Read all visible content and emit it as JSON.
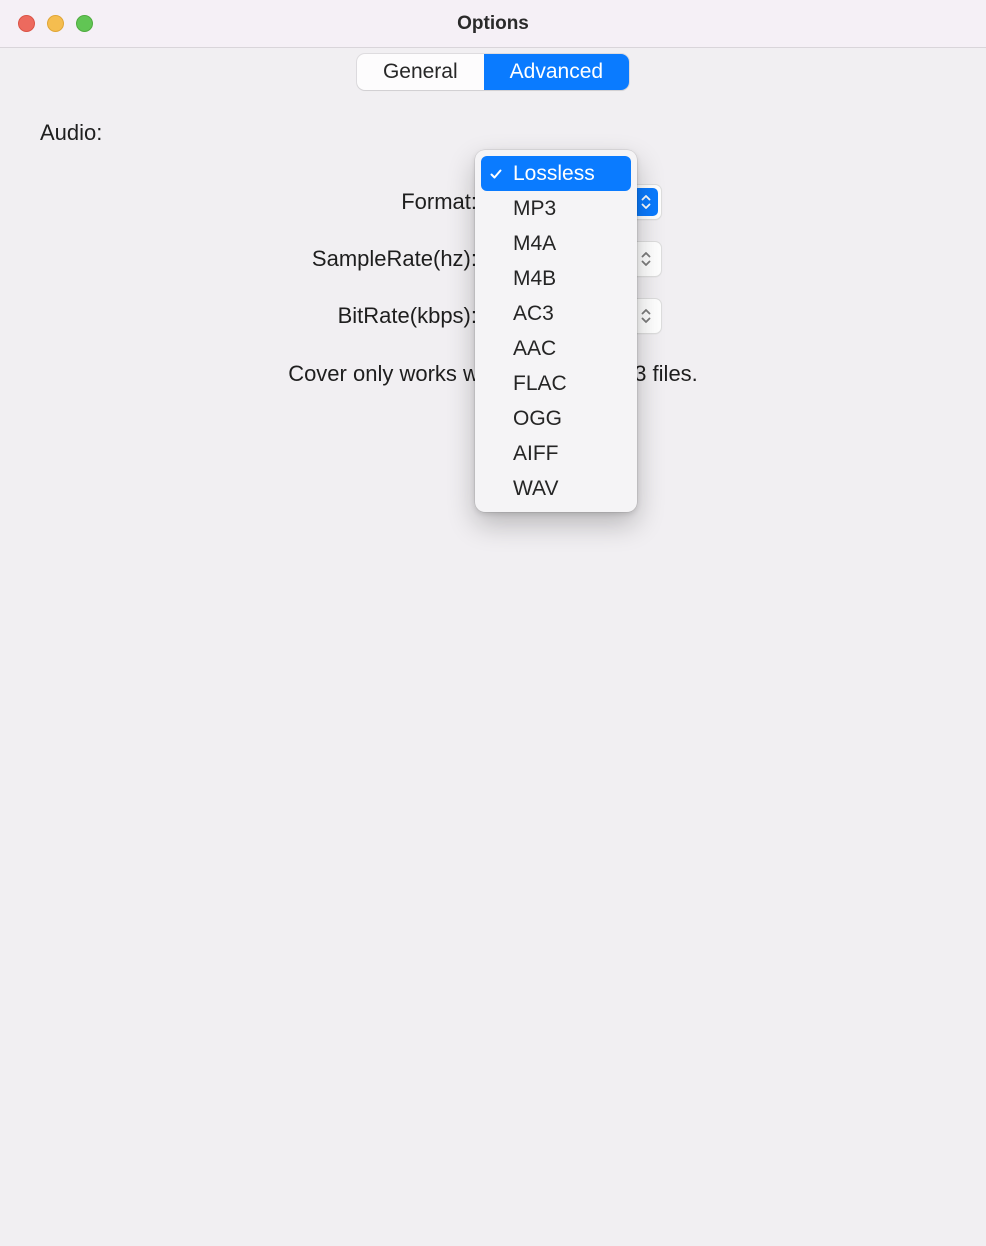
{
  "window": {
    "title": "Options"
  },
  "tabs": {
    "general": "General",
    "advanced": "Advanced"
  },
  "section": {
    "audio": "Audio:"
  },
  "labels": {
    "format": "Format:",
    "sampleRate": "SampleRate(hz):",
    "bitRate": "BitRate(kbps):"
  },
  "selects": {
    "format_value": "",
    "sampleRate_value": "",
    "bitRate_value": ""
  },
  "hint": "Cover only works with M4A and MP3 files.",
  "dropdown": {
    "selected": "Lossless",
    "items": [
      "Lossless",
      "MP3",
      "M4A",
      "M4B",
      "AC3",
      "AAC",
      "FLAC",
      "OGG",
      "AIFF",
      "WAV"
    ]
  }
}
